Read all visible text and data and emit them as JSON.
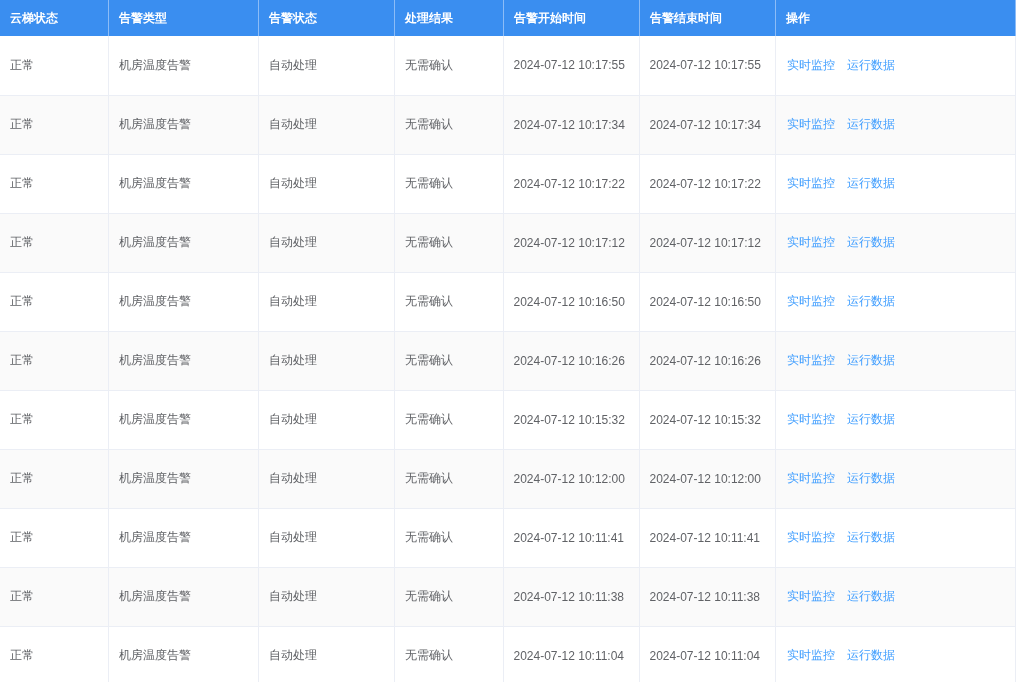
{
  "table": {
    "columns": [
      "云梯状态",
      "告警类型",
      "告警状态",
      "处理结果",
      "告警开始时间",
      "告警结束时间",
      "操作"
    ],
    "rows": [
      {
        "cells": [
          "正常",
          "机房温度告警",
          "自动处理",
          "无需确认",
          "2024-07-12 10:17:55",
          "2024-07-12 10:17:55"
        ],
        "actions": [
          "实时监控",
          "运行数据"
        ]
      },
      {
        "cells": [
          "正常",
          "机房温度告警",
          "自动处理",
          "无需确认",
          "2024-07-12 10:17:34",
          "2024-07-12 10:17:34"
        ],
        "actions": [
          "实时监控",
          "运行数据"
        ]
      },
      {
        "cells": [
          "正常",
          "机房温度告警",
          "自动处理",
          "无需确认",
          "2024-07-12 10:17:22",
          "2024-07-12 10:17:22"
        ],
        "actions": [
          "实时监控",
          "运行数据"
        ]
      },
      {
        "cells": [
          "正常",
          "机房温度告警",
          "自动处理",
          "无需确认",
          "2024-07-12 10:17:12",
          "2024-07-12 10:17:12"
        ],
        "actions": [
          "实时监控",
          "运行数据"
        ]
      },
      {
        "cells": [
          "正常",
          "机房温度告警",
          "自动处理",
          "无需确认",
          "2024-07-12 10:16:50",
          "2024-07-12 10:16:50"
        ],
        "actions": [
          "实时监控",
          "运行数据"
        ]
      },
      {
        "cells": [
          "正常",
          "机房温度告警",
          "自动处理",
          "无需确认",
          "2024-07-12 10:16:26",
          "2024-07-12 10:16:26"
        ],
        "actions": [
          "实时监控",
          "运行数据"
        ]
      },
      {
        "cells": [
          "正常",
          "机房温度告警",
          "自动处理",
          "无需确认",
          "2024-07-12 10:15:32",
          "2024-07-12 10:15:32"
        ],
        "actions": [
          "实时监控",
          "运行数据"
        ]
      },
      {
        "cells": [
          "正常",
          "机房温度告警",
          "自动处理",
          "无需确认",
          "2024-07-12 10:12:00",
          "2024-07-12 10:12:00"
        ],
        "actions": [
          "实时监控",
          "运行数据"
        ]
      },
      {
        "cells": [
          "正常",
          "机房温度告警",
          "自动处理",
          "无需确认",
          "2024-07-12 10:11:41",
          "2024-07-12 10:11:41"
        ],
        "actions": [
          "实时监控",
          "运行数据"
        ]
      },
      {
        "cells": [
          "正常",
          "机房温度告警",
          "自动处理",
          "无需确认",
          "2024-07-12 10:11:38",
          "2024-07-12 10:11:38"
        ],
        "actions": [
          "实时监控",
          "运行数据"
        ]
      },
      {
        "cells": [
          "正常",
          "机房温度告警",
          "自动处理",
          "无需确认",
          "2024-07-12 10:11:04",
          "2024-07-12 10:11:04"
        ],
        "actions": [
          "实时监控",
          "运行数据"
        ]
      }
    ]
  }
}
